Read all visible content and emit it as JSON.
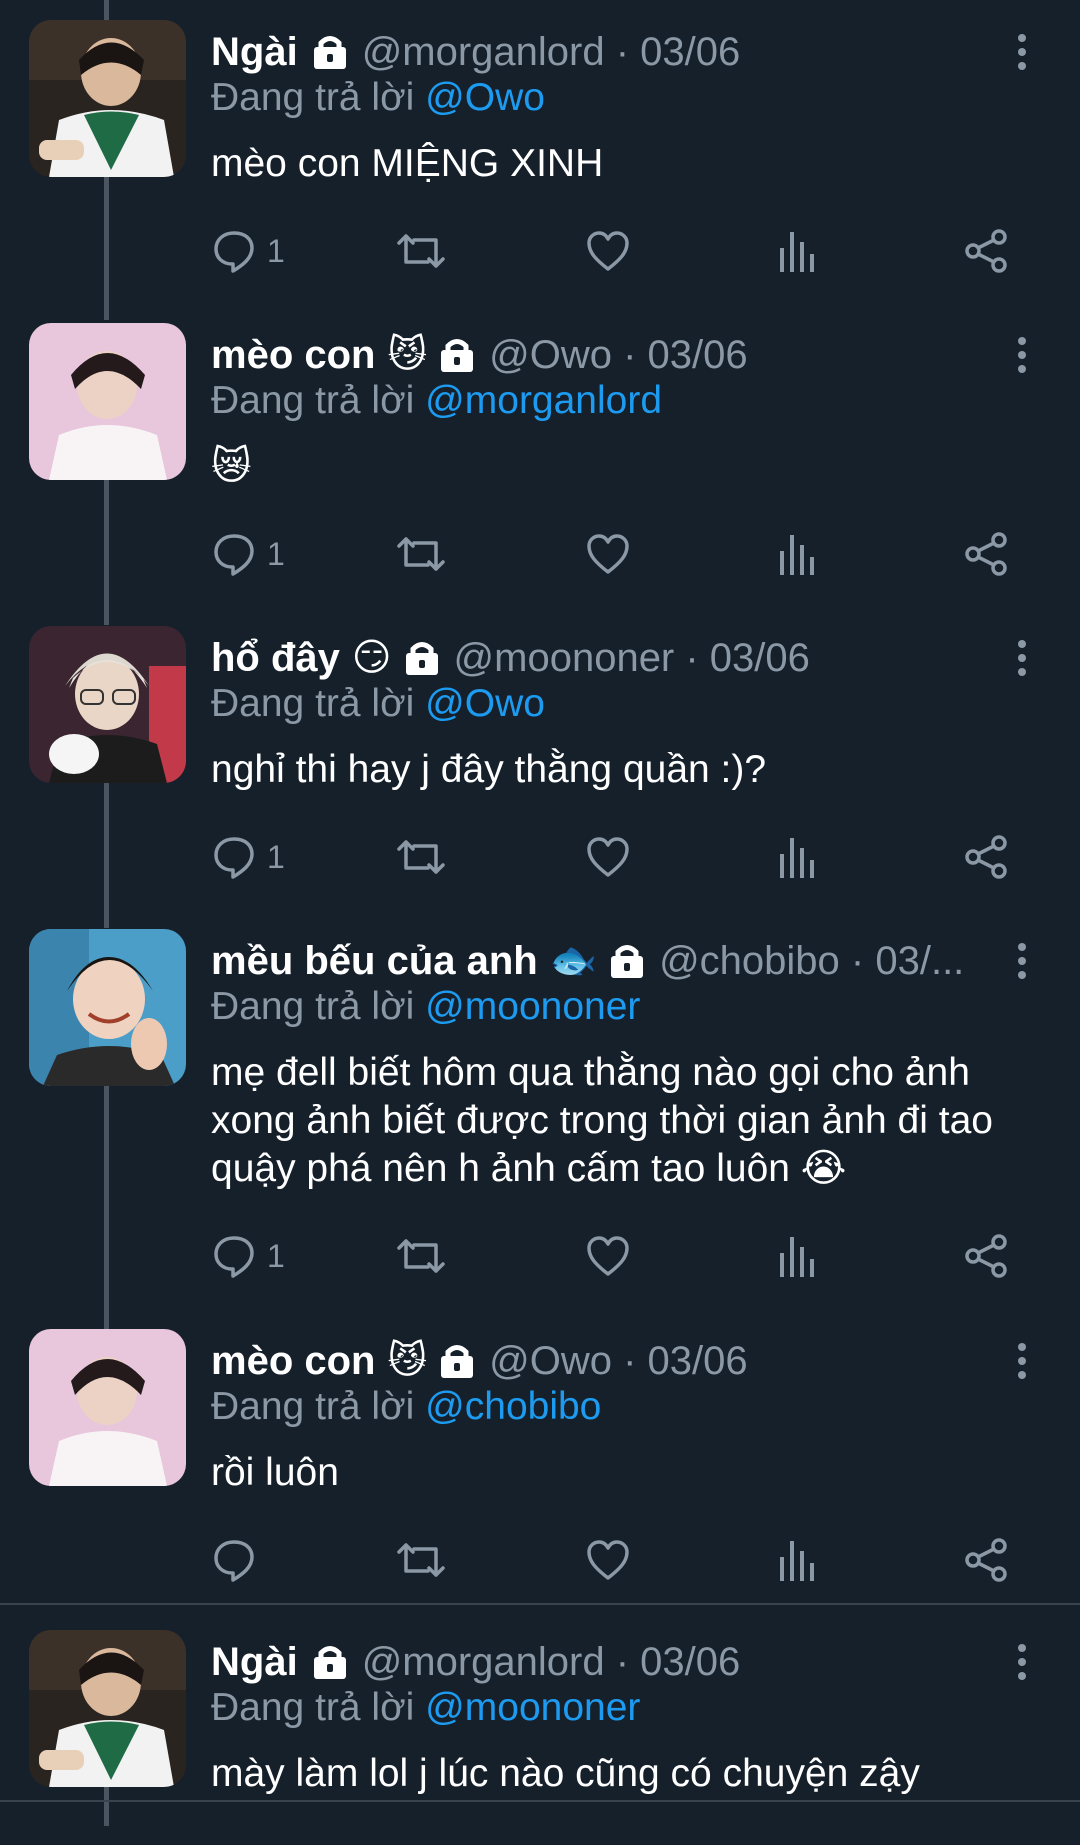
{
  "colors": {
    "background": "#15202b",
    "muted": "#8b98a5",
    "mention": "#1d9bf0",
    "text": "#ffffff"
  },
  "tweets": [
    {
      "name": "Ngài",
      "emoji": "",
      "handle_date": "@morganlord · 03/06",
      "replying_prefix": "Đang trả lời",
      "replying_to": "@Owo",
      "body": "mèo con MIỆNG XINH",
      "reply_count": "1",
      "icons": [
        "lock-icon",
        "more-vertical-icon",
        "reply-icon",
        "retweet-icon",
        "like-icon",
        "views-icon",
        "share-icon"
      ]
    },
    {
      "name": "mèo con",
      "emoji": "😼",
      "handle_date": "@Owo · 03/06",
      "replying_prefix": "Đang trả lời",
      "replying_to": "@morganlord",
      "body": "😿",
      "reply_count": "1"
    },
    {
      "name": "hổ đây",
      "emoji": "😏",
      "handle_date": "@moononer · 03/06",
      "replying_prefix": "Đang trả lời",
      "replying_to": "@Owo",
      "body": "nghỉ thi hay j đây thằng quần :)?",
      "reply_count": "1"
    },
    {
      "name": "mều bếu của anh",
      "emoji": "🐟",
      "handle_date": "@chobibo · 03/...",
      "replying_prefix": "Đang trả lời",
      "replying_to": "@moononer",
      "body": "mẹ đell biết hôm qua thằng nào gọi cho ảnh xong ảnh biết được trong thời gian ảnh đi tao quậy phá nên h ảnh cấm tao luôn 😭",
      "reply_count": "1"
    },
    {
      "name": "mèo con",
      "emoji": "😼",
      "handle_date": "@Owo · 03/06",
      "replying_prefix": "Đang trả lời",
      "replying_to": "@chobibo",
      "body": "rồi luôn",
      "reply_count": ""
    },
    {
      "name": "Ngài",
      "emoji": "",
      "handle_date": "@morganlord · 03/06",
      "replying_prefix": "Đang trả lời",
      "replying_to": "@moononer",
      "body": "mày làm lol j lúc nào cũng có chuyện zậy",
      "reply_count": ""
    }
  ]
}
